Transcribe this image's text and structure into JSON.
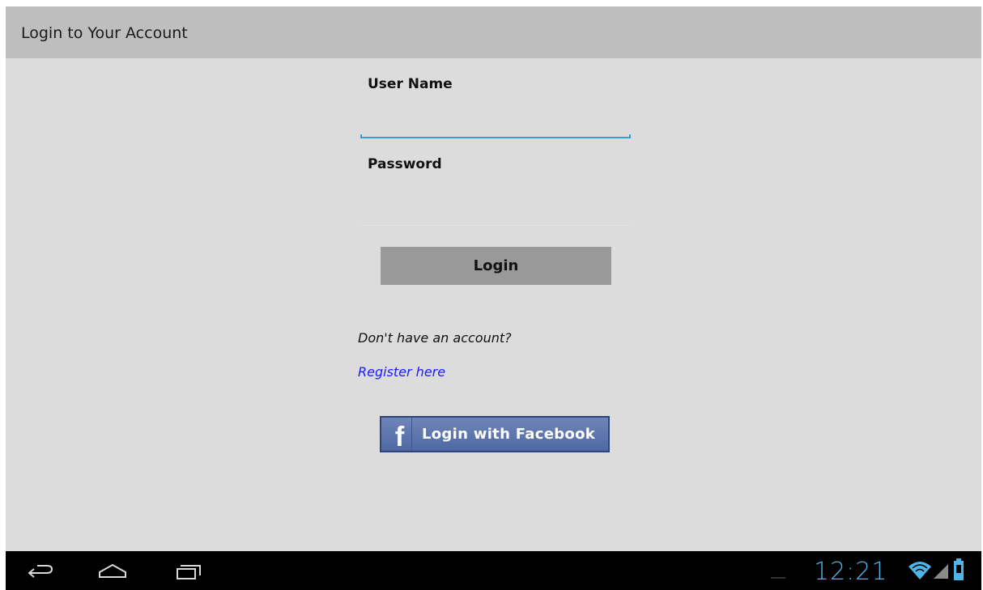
{
  "action_bar": {
    "title": "Login to Your Account"
  },
  "form": {
    "username_label": "User Name",
    "username_value": "",
    "password_label": "Password",
    "password_value": "",
    "login_button_label": "Login",
    "no_account_prompt": "Don't have an account?",
    "register_link_label": "Register here",
    "facebook_button_label": "Login with Facebook",
    "facebook_icon_glyph": "f"
  },
  "system_bar": {
    "clock": "12:21",
    "icons": [
      "back-icon",
      "home-icon",
      "recent-apps-icon",
      "wifi-icon",
      "signal-icon",
      "battery-icon"
    ]
  },
  "colors": {
    "focus_accent": "#2e9fd8",
    "link": "#1a1aff",
    "facebook_blue": "#4e68a3",
    "clock": "#4fb5e6"
  }
}
